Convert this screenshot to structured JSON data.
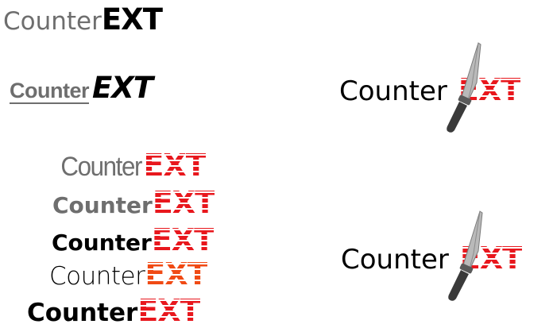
{
  "logos": [
    {
      "counter": "Counter",
      "ext": "EXT"
    },
    {
      "counter": "Counter",
      "ext": "EXT"
    },
    {
      "counter": "Counter",
      "ext": "EXT"
    },
    {
      "counter": "Counter",
      "ext": "EXT"
    },
    {
      "counter": "Counter",
      "ext": "EXT"
    },
    {
      "counter": "Counter",
      "ext": "EXT"
    },
    {
      "counter": "Counter",
      "ext": "EXT"
    },
    {
      "counter": "Counter",
      "ext": "EXT"
    },
    {
      "counter": "Counter",
      "ext": "EXT"
    }
  ],
  "colors": {
    "gray": "#6e6e6e",
    "black": "#000000",
    "red": "#e8171d",
    "orange": "#f04a14"
  },
  "icons": [
    "knife-icon",
    "knife-icon"
  ]
}
